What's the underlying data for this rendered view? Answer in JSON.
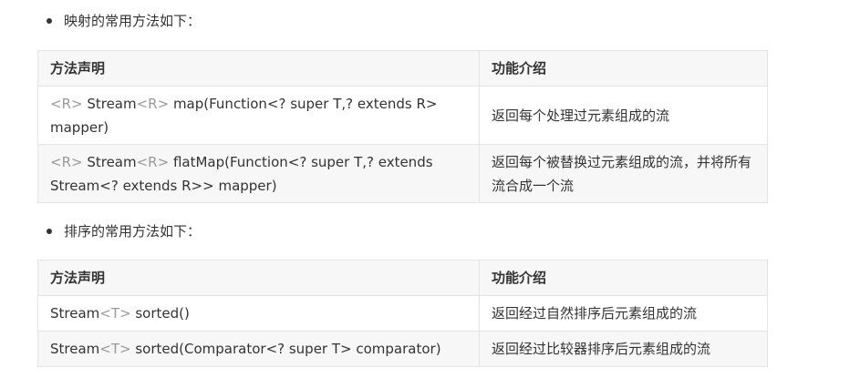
{
  "section1": {
    "bullet": "映射的常用方法如下：",
    "headers": [
      "方法声明",
      "功能介绍"
    ],
    "rows": [
      {
        "method_parts": [
          "<R>",
          " Stream",
          "<R>",
          " map(Function<? super T,? extends R> mapper)"
        ],
        "desc": "返回每个处理过元素组成的流"
      },
      {
        "method_parts": [
          "<R>",
          " Stream",
          "<R>",
          " flatMap(Function<? super T,? extends Stream<? extends R>> mapper)"
        ],
        "desc": "返回每个被替换过元素组成的流，并将所有流合成一个流"
      }
    ]
  },
  "section2": {
    "bullet": "排序的常用方法如下：",
    "headers": [
      "方法声明",
      "功能介绍"
    ],
    "rows": [
      {
        "method_parts": [
          "Stream",
          "<T>",
          " sorted()"
        ],
        "desc": "返回经过自然排序后元素组成的流"
      },
      {
        "method_parts": [
          "Stream",
          "<T>",
          " sorted(Comparator<? super T> comparator)"
        ],
        "desc": "返回经过比较器排序后元素组成的流"
      }
    ]
  },
  "colors": {
    "text": "#333333",
    "generic_type": "#999999",
    "header_bg": "#f7f7f7",
    "border": "#e4e4e4"
  }
}
